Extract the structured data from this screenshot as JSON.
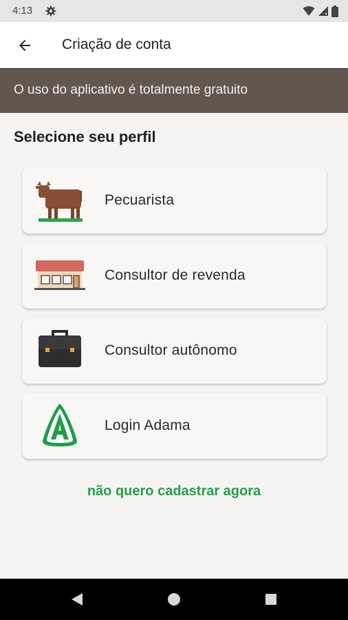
{
  "status_bar": {
    "time": "4:13",
    "icons": [
      "gear-icon",
      "wifi-icon",
      "signal-icon",
      "battery-icon"
    ]
  },
  "app_bar": {
    "back_icon": "arrow-left-icon",
    "title": "Criação de conta"
  },
  "banner": {
    "text": "O uso do aplicativo é totalmente gratuito"
  },
  "section": {
    "title": "Selecione seu perfil"
  },
  "profiles": [
    {
      "label": "Pecuarista",
      "icon": "cow-icon"
    },
    {
      "label": "Consultor de revenda",
      "icon": "store-icon"
    },
    {
      "label": "Consultor autônomo",
      "icon": "briefcase-icon"
    },
    {
      "label": "Login Adama",
      "icon": "adama-logo-icon"
    }
  ],
  "skip_link": "não quero cadastrar agora",
  "nav_bar": {
    "buttons": [
      "back-triangle-icon",
      "home-circle-icon",
      "recents-square-icon"
    ]
  },
  "colors": {
    "banner": "#62574f",
    "accent_green": "#22a149",
    "background": "#f5f4f2"
  }
}
